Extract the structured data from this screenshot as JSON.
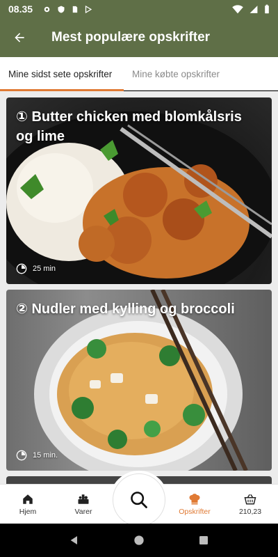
{
  "status_bar": {
    "time": "08.35"
  },
  "app_bar": {
    "title": "Mest populære opskrifter"
  },
  "tabs": [
    {
      "label": "Mine sidst sete opskrifter"
    },
    {
      "label": "Mine købte opskrifter"
    }
  ],
  "recipes": [
    {
      "title": "① Butter chicken med blomkålsris og lime",
      "time": "25 min"
    },
    {
      "title": "② Nudler med kylling og broccoli",
      "time": "15 min."
    }
  ],
  "bottom_nav": {
    "home": "Hjem",
    "products": "Varer",
    "recipes": "Opskrifter",
    "basket": "210,23"
  },
  "colors": {
    "header": "#5f6f47",
    "accent": "#e07a34"
  }
}
